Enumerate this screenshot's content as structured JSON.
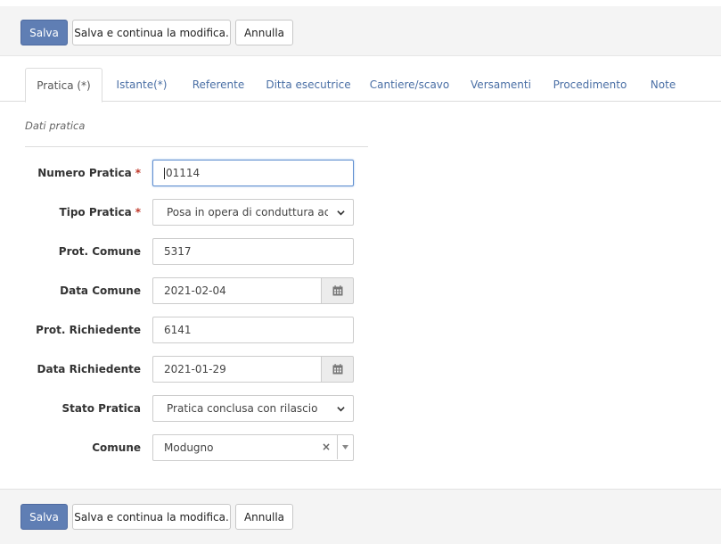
{
  "toolbar": {
    "save_label": "Salva",
    "save_continue_label": "Salva e continua la modifica.",
    "cancel_label": "Annulla"
  },
  "tabs": [
    {
      "label": "Pratica (*)",
      "active": true
    },
    {
      "label": "Istante(*)"
    },
    {
      "label": "Referente"
    },
    {
      "label": "Ditta esecutrice"
    },
    {
      "label": "Cantiere/scavo"
    },
    {
      "label": "Versamenti"
    },
    {
      "label": "Procedimento"
    },
    {
      "label": "Note"
    }
  ],
  "section": {
    "title": "Dati pratica"
  },
  "form": {
    "numero_pratica": {
      "label": "Numero Pratica",
      "required_mark": "*",
      "value": "01114"
    },
    "tipo_pratica": {
      "label": "Tipo Pratica",
      "required_mark": "*",
      "value": "Posa in opera di conduttura acque"
    },
    "prot_comune": {
      "label": "Prot. Comune",
      "value": "5317"
    },
    "data_comune": {
      "label": "Data Comune",
      "value": "2021-02-04"
    },
    "prot_richiedente": {
      "label": "Prot. Richiedente",
      "value": "6141"
    },
    "data_richiedente": {
      "label": "Data Richiedente",
      "value": "2021-01-29"
    },
    "stato_pratica": {
      "label": "Stato Pratica",
      "value": "Pratica conclusa con rilascio"
    },
    "comune": {
      "label": "Comune",
      "value": "Modugno",
      "clear_glyph": "×"
    }
  },
  "icons": {
    "calendar": "calendar-icon",
    "select_arrow": "chevron-down-icon",
    "clear": "clear-icon"
  },
  "colors": {
    "primary": "#5f7eb4",
    "link": "#4a6fa5",
    "required": "#c0392b",
    "focus": "#5f8fd0"
  }
}
